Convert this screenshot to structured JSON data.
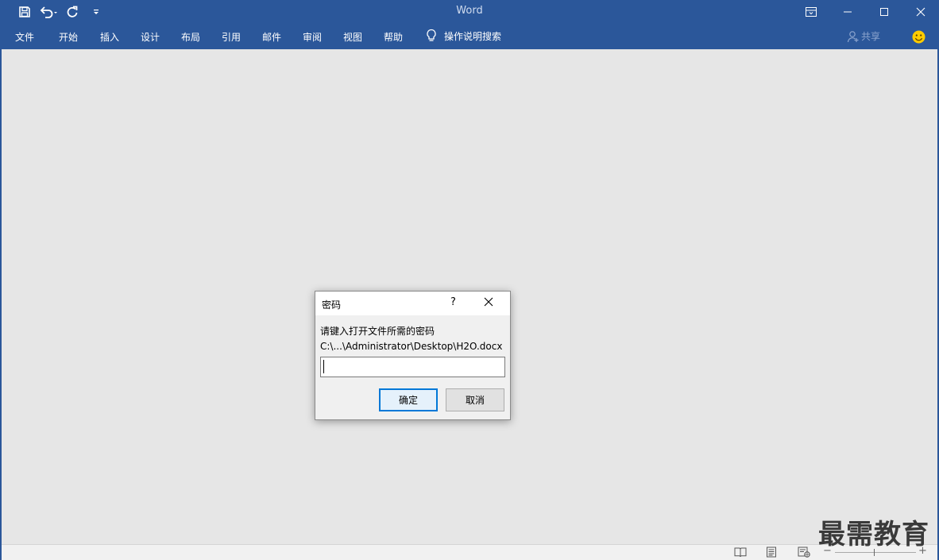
{
  "app": {
    "title": "Word"
  },
  "ribbon": {
    "tabs": [
      {
        "label": "文件"
      },
      {
        "label": "开始"
      },
      {
        "label": "插入"
      },
      {
        "label": "设计"
      },
      {
        "label": "布局"
      },
      {
        "label": "引用"
      },
      {
        "label": "邮件"
      },
      {
        "label": "审阅"
      },
      {
        "label": "视图"
      },
      {
        "label": "帮助"
      }
    ],
    "tell_me": "操作说明搜索",
    "share": "共享"
  },
  "dialog": {
    "title": "密码",
    "help": "?",
    "prompt": "请键入打开文件所需的密码",
    "path": "C:\\...\\Administrator\\Desktop\\H2O.docx",
    "password_value": "",
    "ok_label": "确定",
    "cancel_label": "取消"
  },
  "statusbar": {
    "zoom_minus": "−",
    "zoom_plus": "+"
  },
  "watermark": {
    "text": "最需教育"
  },
  "colors": {
    "accent": "#2b579a",
    "canvas": "#e6e6e6",
    "dialog_default_border": "#0078d7"
  },
  "icons": {
    "qat": [
      "save-icon",
      "undo-icon",
      "redo-icon",
      "customize-icon"
    ],
    "window": [
      "ribbon-display-icon",
      "minimize-icon",
      "maximize-icon",
      "close-icon"
    ],
    "status": [
      "read-mode-icon",
      "print-layout-icon",
      "web-layout-icon"
    ]
  }
}
